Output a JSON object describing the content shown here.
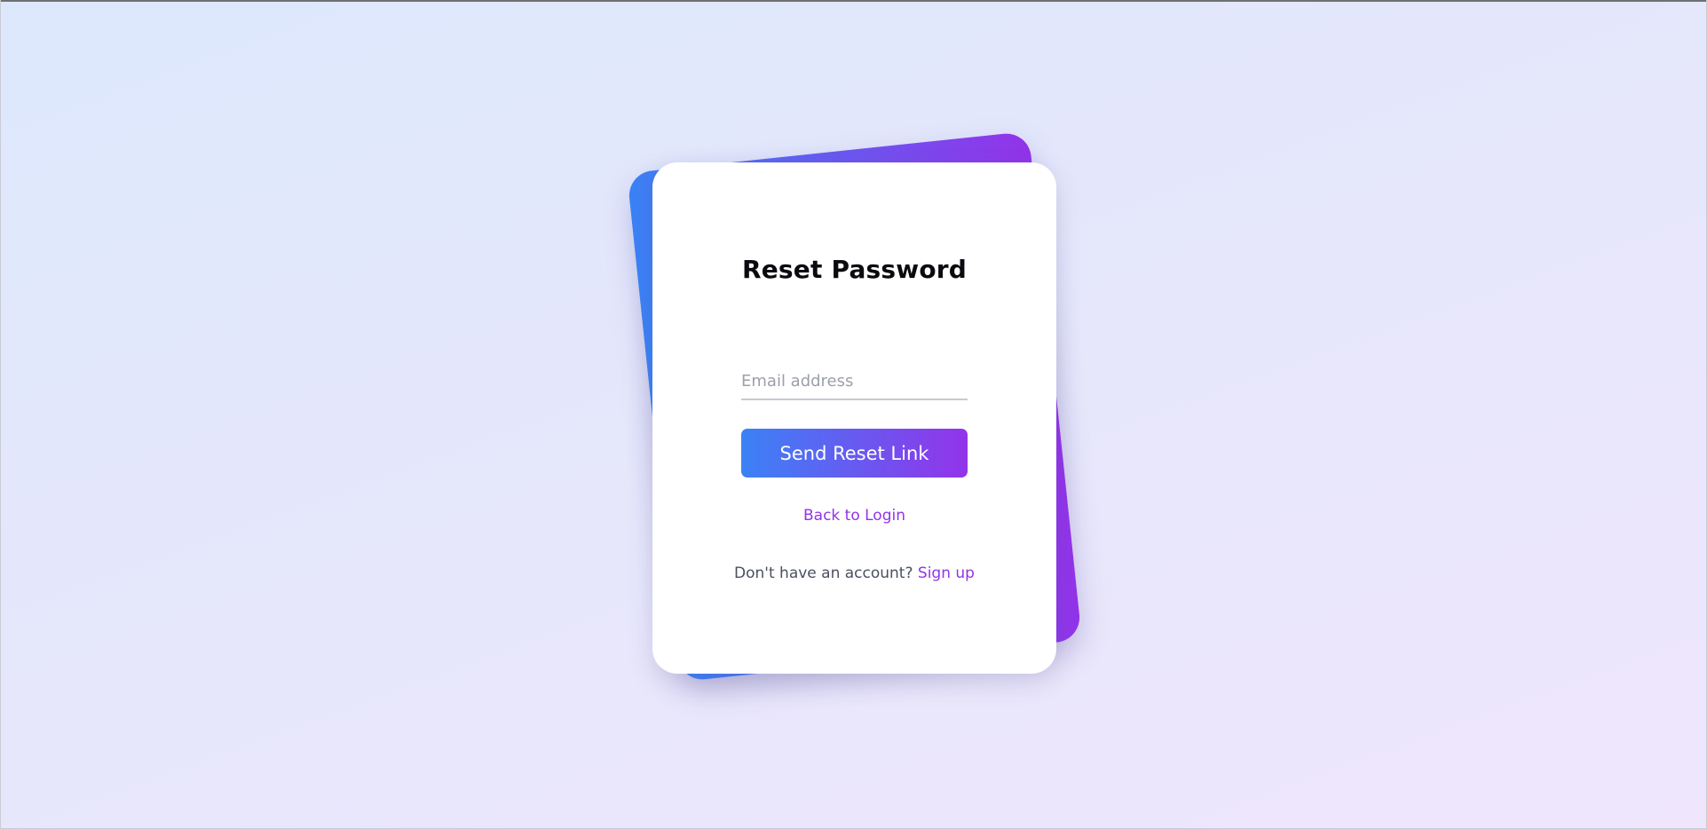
{
  "form": {
    "title": "Reset Password",
    "email_placeholder": "Email address",
    "email_value": "",
    "send_button_label": "Send Reset Link",
    "back_link_label": "Back to Login",
    "signup_prompt": "Don't have an account?",
    "signup_link_label": "Sign up"
  },
  "theme": {
    "accent_start": "#3b82f6",
    "accent_end": "#9333ea",
    "link_color": "#9333ea"
  }
}
